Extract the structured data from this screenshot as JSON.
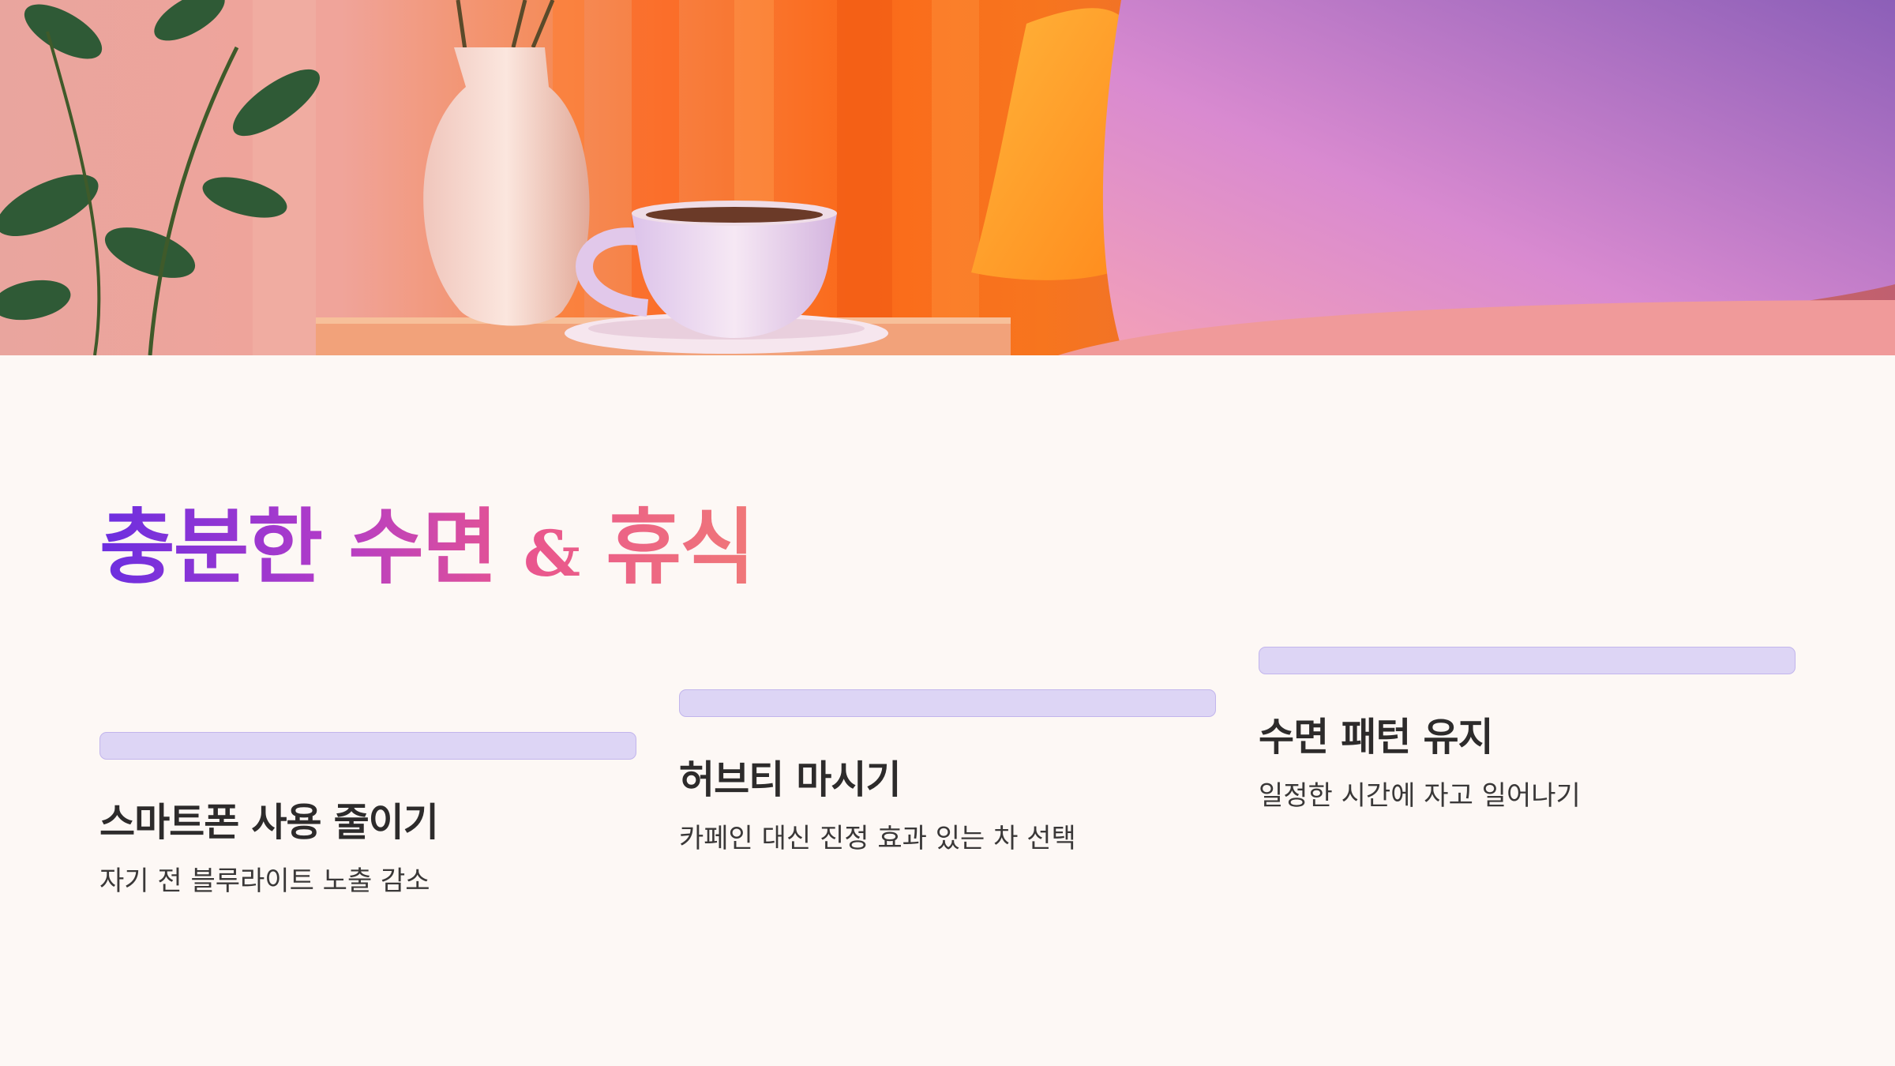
{
  "hero": {
    "image": "bedroom-tea-photo"
  },
  "title": {
    "part1": "충분한 수면",
    "amp": "&",
    "part2": "휴식"
  },
  "cards": [
    {
      "title": "스마트폰 사용 줄이기",
      "description": "자기 전 블루라이트 노출 감소"
    },
    {
      "title": "허브티 마시기",
      "description": "카페인 대신 진정 효과 있는 차 선택"
    },
    {
      "title": "수면 패턴 유지",
      "description": "일정한 시간에 자고 일어나기"
    }
  ],
  "colors": {
    "background": "#fdf8f5",
    "bar_fill": "#ddd5f5",
    "bar_border": "#c2b5ec",
    "title_gradient_start": "#6b2ee0",
    "title_gradient_end": "#f07878",
    "text_dark": "#2d2b2b"
  }
}
